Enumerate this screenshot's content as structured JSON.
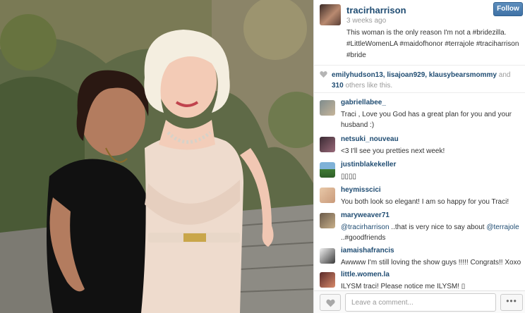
{
  "post": {
    "owner": "tracirharrison",
    "time": "3 weeks ago",
    "caption": "This woman is the only reason I'm not a #bridezilla. #LittleWomenLA #maidofhonor #terrajole #traciharrison #bride",
    "follow_label": "Follow"
  },
  "likes": {
    "users": "emilyhudson13, lisajoan929, klausybearsmommy",
    "and_text": "and",
    "count_text": "310",
    "rest_text": "others like this."
  },
  "comments": [
    {
      "user": "gabriellabee_",
      "text": "Traci , Love you God has a great plan for you and your husband :)"
    },
    {
      "user": "netsuki_nouveau",
      "text": "<3 I'll see you pretties next week!"
    },
    {
      "user": "justinblakekeller",
      "text": "▯▯▯▯"
    },
    {
      "user": "heymisscici",
      "text": "You both look so elegant! I am so happy for you Traci!"
    },
    {
      "user": "maryweaver71",
      "mention1": "@tracirharrison",
      "text_mid": "..that is very nice to say about",
      "mention2": "@terrajole",
      "text_end": "..#goodfriends"
    },
    {
      "user": "iamaishafrancis",
      "text": "Awwww I'm still loving the show guys !!!!! Congrats!! Xoxo"
    },
    {
      "user": "little.women.la",
      "text": "ILYSM traci! Please notice me ILYSM! ▯"
    }
  ],
  "footer": {
    "comment_placeholder": "Leave a comment...",
    "more_label": "•••"
  },
  "icons": {
    "heart": "heart-icon",
    "more": "more-options-icon"
  },
  "colors": {
    "link": "#1f4c72",
    "follow_button": "#3f72a6",
    "muted": "#9a9a9a"
  }
}
